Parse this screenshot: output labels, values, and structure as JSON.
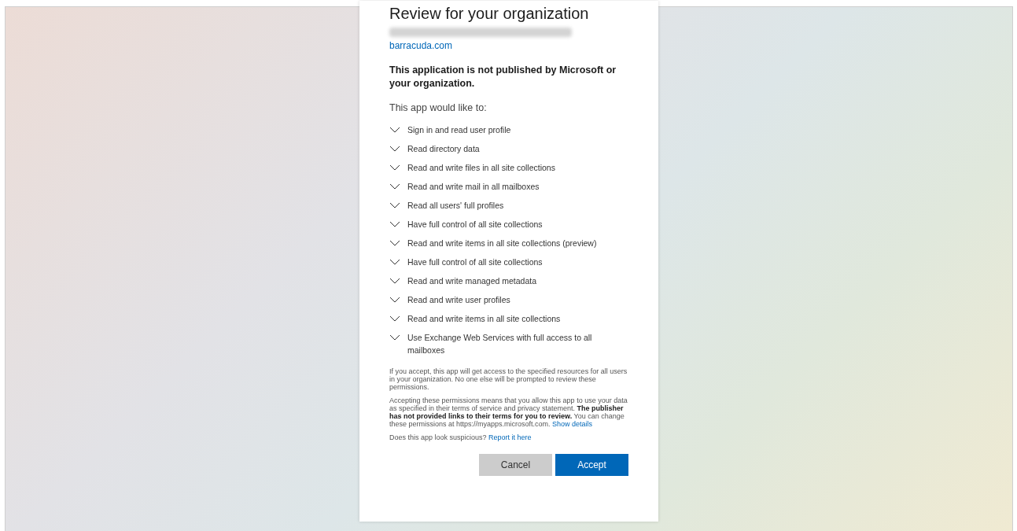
{
  "dialog": {
    "title": "Review for your organization",
    "publisher_domain": "barracuda.com",
    "warning": "This application is not published by Microsoft or your organization.",
    "intro": "This app would like to:",
    "permissions": [
      {
        "label": "Sign in and read user profile"
      },
      {
        "label": "Read directory data"
      },
      {
        "label": "Read and write files in all site collections"
      },
      {
        "label": "Read and write mail in all mailboxes"
      },
      {
        "label": "Read all users' full profiles"
      },
      {
        "label": "Have full control of all site collections"
      },
      {
        "label": "Read and write items in all site collections (preview)"
      },
      {
        "label": "Have full control of all site collections"
      },
      {
        "label": "Read and write managed metadata"
      },
      {
        "label": "Read and write user profiles"
      },
      {
        "label": "Read and write items in all site collections"
      },
      {
        "label": "Use Exchange Web Services with full access to all mailboxes"
      }
    ],
    "notice": "If you accept, this app will get access to the specified resources for all users in your organization. No one else will be prompted to review these permissions.",
    "terms": {
      "text": "Accepting these permissions means that you allow this app to use your data as specified in their terms of service and privacy statement. **The publisher has not provided links to their terms for you to review.** You can change these permissions at https://myapps.microsoft.com.",
      "link": "Show details"
    },
    "report": {
      "text": "Does this app look suspicious?",
      "link": "Report it here"
    },
    "buttons": [
      {
        "label": "Cancel",
        "kind": "secondary"
      },
      {
        "label": "Accept",
        "kind": "primary"
      }
    ]
  }
}
